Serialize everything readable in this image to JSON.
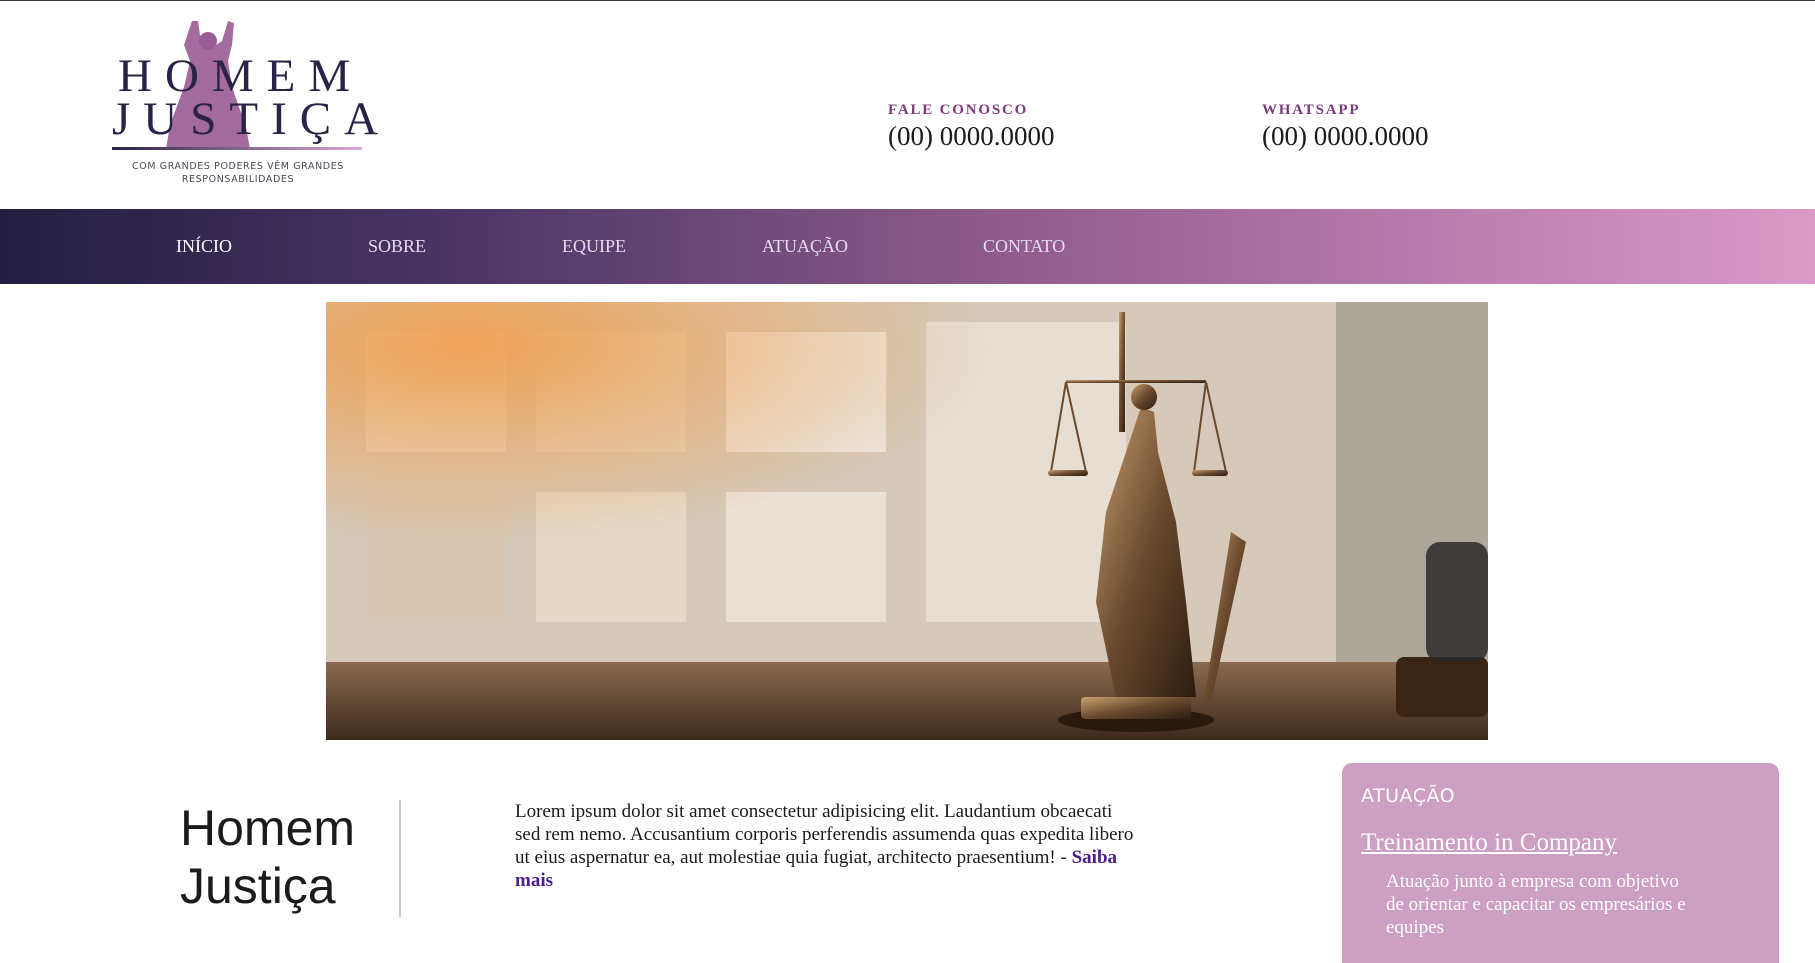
{
  "logo": {
    "line1": "HOMEM",
    "line2": "JUSTIÇA",
    "tagline": "COM GRANDES PODERES VÊM GRANDES RESPONSABILIDADES"
  },
  "contacts": [
    {
      "label": "FALE CONOSCO",
      "value": "(00) 0000.0000"
    },
    {
      "label": "WHATSAPP",
      "value": "(00) 0000.0000"
    }
  ],
  "nav": {
    "items": [
      {
        "label": "INÍCIO",
        "active": true
      },
      {
        "label": "SOBRE",
        "active": false
      },
      {
        "label": "EQUIPE",
        "active": false
      },
      {
        "label": "ATUAÇÃO",
        "active": false
      },
      {
        "label": "CONTATO",
        "active": false
      }
    ],
    "gradient": [
      "#221d41",
      "#dc99c8"
    ]
  },
  "about": {
    "title_line1": "Homem",
    "title_line2": "Justiça",
    "text": "Lorem ipsum dolor sit amet consectetur adipisicing elit. Laudantium obcaecati sed rem nemo. Accusantium corporis perferendis assumenda quas expedita libero ut eius aspernatur ea, aut molestiae quia fugiat, architecto praesentium! - ",
    "more_link": "Saiba mais"
  },
  "panel": {
    "title": "ATUAÇÃO",
    "link": "Treinamento in Company",
    "description": "Atuação junto à empresa com objetivo de orientar e capacitar os empresários e equipes",
    "background": "#cc9fc3"
  },
  "colors": {
    "brand_dark": "#2a2347",
    "accent_purple": "#7b3a7a",
    "link_purple": "#4a1f8a"
  }
}
